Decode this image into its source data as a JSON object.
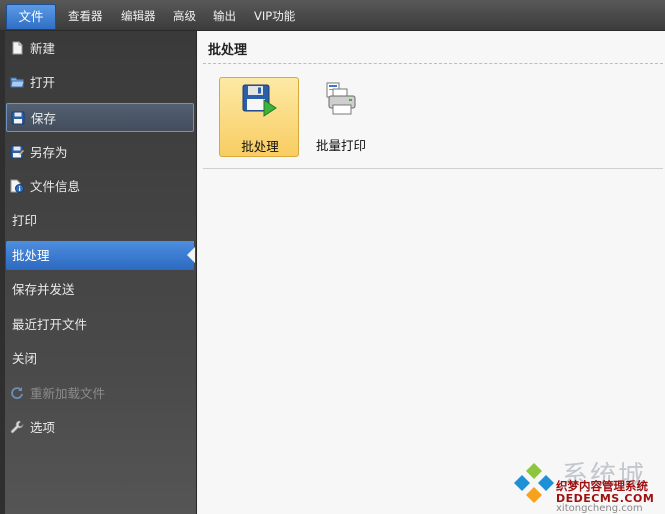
{
  "menubar": {
    "items": [
      "文件",
      "查看器",
      "编辑器",
      "高级",
      "输出",
      "VIP功能"
    ]
  },
  "sidebar": {
    "items": [
      {
        "label": "新建",
        "icon": "new-document-icon",
        "state": "normal"
      },
      {
        "label": "打开",
        "icon": "open-folder-icon",
        "state": "normal"
      },
      {
        "label": "保存",
        "icon": "floppy-disk-icon",
        "state": "hover"
      },
      {
        "label": "另存为",
        "icon": "save-as-icon",
        "state": "normal"
      },
      {
        "label": "文件信息",
        "icon": "file-info-icon",
        "state": "normal"
      },
      {
        "label": "打印",
        "icon": "",
        "state": "normal"
      },
      {
        "label": "批处理",
        "icon": "",
        "state": "selected"
      },
      {
        "label": "保存并发送",
        "icon": "",
        "state": "normal"
      },
      {
        "label": "最近打开文件",
        "icon": "",
        "state": "normal"
      },
      {
        "label": "关闭",
        "icon": "",
        "state": "normal"
      },
      {
        "label": "重新加载文件",
        "icon": "reload-icon",
        "state": "disabled"
      },
      {
        "label": "选项",
        "icon": "wrench-icon",
        "state": "normal"
      }
    ]
  },
  "main": {
    "title": "批处理",
    "buttons": [
      {
        "label": "批处理",
        "icon": "batch-save-icon",
        "state": "selected"
      },
      {
        "label": "批量打印",
        "icon": "batch-print-icon",
        "state": "normal"
      }
    ]
  },
  "watermark": {
    "big_text": "系统城",
    "line1": "织梦内容管理系统",
    "line2": "DEDECMS.COM",
    "line3": "xitongcheng.com"
  },
  "colors": {
    "accent": "#2f6fc4",
    "selected_yellow": "#f8cd62",
    "sidebar_bg": "#444444"
  }
}
